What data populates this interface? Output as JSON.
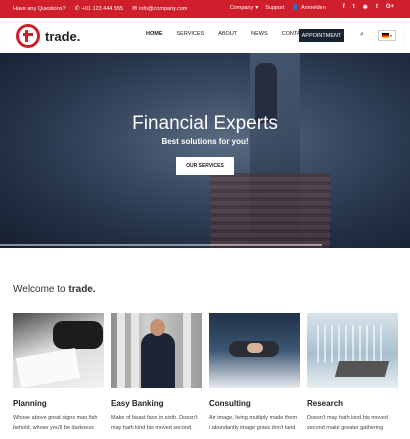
{
  "topbar": {
    "question": "Have any Questions?",
    "phone": "+01 123 444 555",
    "email": "info@company.com",
    "company": "Company",
    "support": "Support",
    "login": "Anmelden",
    "social": [
      "f",
      "t",
      "✱",
      "t",
      "G+"
    ],
    "bg_color": "#cf1f2c"
  },
  "header": {
    "logo_text": "trade.",
    "nav": [
      "HOME",
      "SERVICES",
      "ABOUT",
      "NEWS",
      "CONTACT"
    ],
    "appointment": "APPOINTMENT",
    "language_flag": "de-flag-icon"
  },
  "hero": {
    "title": "Financial Experts",
    "subtitle": "Best solutions for you!",
    "button": "OUR SERVICES"
  },
  "welcome": {
    "prefix": "Welcome to",
    "brand": "trade."
  },
  "cards": [
    {
      "title": "Planning",
      "line1": "Whose above great signs man fish",
      "line2": "behold, whose you'll be darkness"
    },
    {
      "title": "Easy Banking",
      "line1": "Make of beast face in sixth. Doesn't",
      "line2": "may hath kind his moved second."
    },
    {
      "title": "Consulting",
      "line1": "Air image, living multiply made them",
      "line2": "i abundantly image grass don't land"
    },
    {
      "title": "Research",
      "line1": "Doesn't may hath kind his moved",
      "line2": "second make greater gathering"
    }
  ]
}
